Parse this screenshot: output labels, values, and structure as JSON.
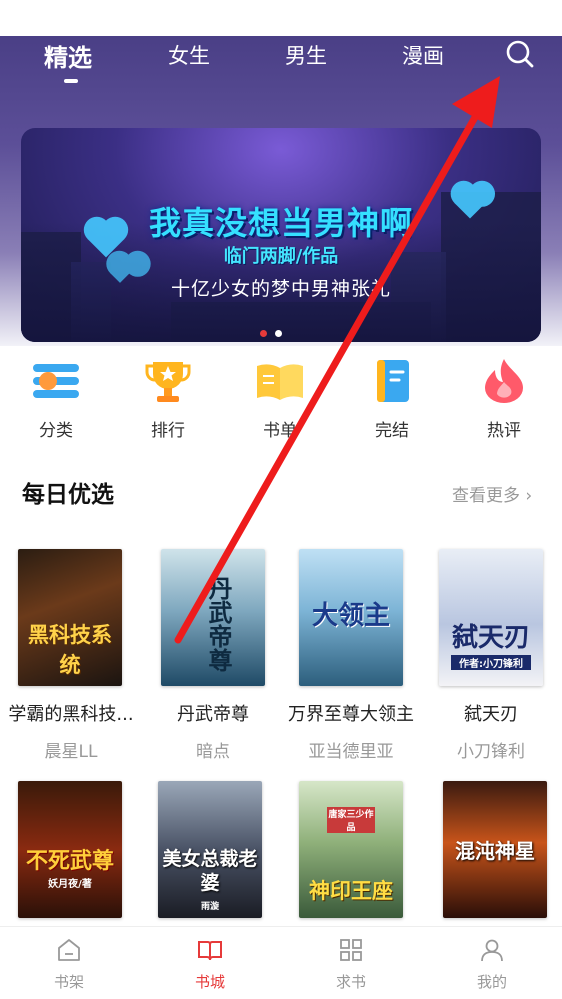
{
  "top_tabs": [
    {
      "label": "精选",
      "active": true
    },
    {
      "label": "女生",
      "active": false
    },
    {
      "label": "男生",
      "active": false
    },
    {
      "label": "漫画",
      "active": false
    }
  ],
  "banner": {
    "title": "我真没想当男神啊",
    "author": "临门两脚/作品",
    "tagline": "十亿少女的梦中男神张礼",
    "page_count": 2,
    "active_page": 1
  },
  "categories": [
    {
      "label": "分类",
      "icon": "list-icon"
    },
    {
      "label": "排行",
      "icon": "trophy-icon"
    },
    {
      "label": "书单",
      "icon": "open-book-icon"
    },
    {
      "label": "完结",
      "icon": "book-icon"
    },
    {
      "label": "热评",
      "icon": "flame-icon"
    }
  ],
  "section": {
    "title": "每日优选",
    "more": "查看更多 ›"
  },
  "books": [
    {
      "name": "学霸的黑科技...",
      "author": "晨星LL",
      "cover_text": "黑科技系统"
    },
    {
      "name": "丹武帝尊",
      "author": "暗点",
      "cover_text": "丹武帝尊"
    },
    {
      "name": "万界至尊大领主",
      "author": "亚当德里亚",
      "cover_text": "大领主"
    },
    {
      "name": "弑天刃",
      "author": "小刀锋利",
      "cover_text": "弑天刃",
      "cover_subtext": "作者:小刀锋利"
    },
    {
      "name": "",
      "author": "",
      "cover_text": "不死武尊",
      "cover_subtext": "妖月夜/著"
    },
    {
      "name": "",
      "author": "",
      "cover_text": "美女总裁老婆",
      "cover_subtext": "雨漩"
    },
    {
      "name": "",
      "author": "",
      "cover_text": "神印王座",
      "cover_subtext": "唐家三少作品"
    },
    {
      "name": "",
      "author": "",
      "cover_text": "混沌神星"
    }
  ],
  "bottom_nav": [
    {
      "label": "书架",
      "icon": "home-icon",
      "active": false
    },
    {
      "label": "书城",
      "icon": "open-book-icon",
      "active": true
    },
    {
      "label": "求书",
      "icon": "grid-icon",
      "active": false
    },
    {
      "label": "我的",
      "icon": "user-icon",
      "active": false
    }
  ],
  "colors": {
    "accent": "#e63a3a",
    "header": "#4a3f86",
    "banner_text": "#35e0ff"
  }
}
